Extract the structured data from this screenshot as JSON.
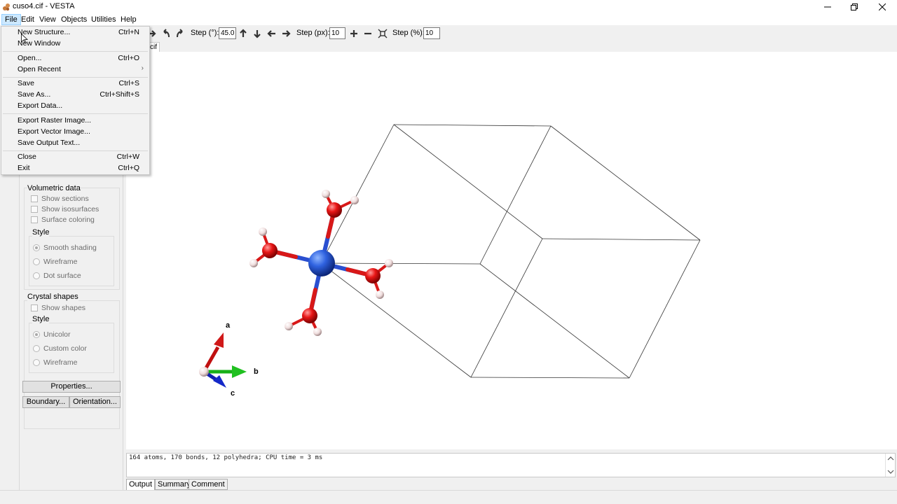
{
  "window": {
    "title": "cuso4.cif - VESTA",
    "colors": {
      "accent": "#cce8ff",
      "viewer_bg": "#ffffff"
    }
  },
  "menubar": {
    "items": [
      "File",
      "Edit",
      "View",
      "Objects",
      "Utilities",
      "Help"
    ]
  },
  "toolbar": {
    "step_deg_label": "Step (°):",
    "step_deg_value": "45.0",
    "step_px_label": "Step (px):",
    "step_px_value": "10",
    "step_pct_label": "Step (%):",
    "step_pct_value": "10"
  },
  "file_tab": {
    "label": "cif"
  },
  "file_menu": {
    "items": [
      {
        "label": "New Structure...",
        "shortcut": "Ctrl+N"
      },
      {
        "label": "New Window",
        "shortcut": ""
      },
      {
        "label": "Open...",
        "shortcut": "Ctrl+O"
      },
      {
        "label": "Open Recent",
        "shortcut": ""
      },
      {
        "label": "Save",
        "shortcut": "Ctrl+S"
      },
      {
        "label": "Save As...",
        "shortcut": "Ctrl+Shift+S"
      },
      {
        "label": "Export Data...",
        "shortcut": ""
      },
      {
        "label": "Export Raster Image...",
        "shortcut": ""
      },
      {
        "label": "Export Vector Image...",
        "shortcut": ""
      },
      {
        "label": "Save Output Text...",
        "shortcut": ""
      },
      {
        "label": "Close",
        "shortcut": "Ctrl+W"
      },
      {
        "label": "Exit",
        "shortcut": "Ctrl+Q"
      }
    ]
  },
  "left_panel": {
    "volumetric": {
      "title": "Volumetric data",
      "show_sections": "Show sections",
      "show_isosurfaces": "Show isosurfaces",
      "surface_coloring": "Surface coloring",
      "style_title": "Style",
      "smooth": "Smooth shading",
      "wireframe": "Wireframe",
      "dot": "Dot surface"
    },
    "crystal": {
      "title": "Crystal shapes",
      "show_shapes": "Show shapes",
      "style_title": "Style",
      "unicolor": "Unicolor",
      "custom": "Custom color",
      "wireframe": "Wireframe"
    },
    "properties_btn": "Properties...",
    "boundary_btn": "Boundary...",
    "orientation_btn": "Orientation..."
  },
  "viewer": {
    "axis_a": "a",
    "axis_b": "b",
    "axis_c": "c"
  },
  "output": {
    "text": "164 atoms, 170 bonds, 12 polyhedra; CPU time = 3 ms"
  },
  "bottom_tabs": [
    "Output",
    "Summary",
    "Comment"
  ]
}
